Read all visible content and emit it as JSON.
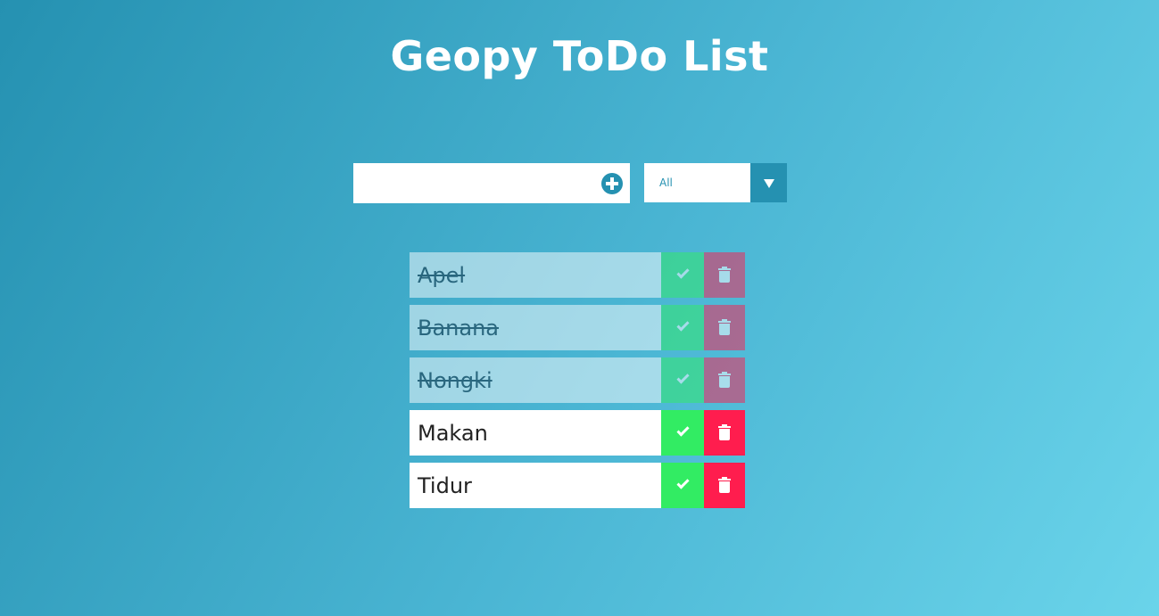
{
  "app": {
    "title": "Geopy ToDo List"
  },
  "form": {
    "input_value": "",
    "input_placeholder": "",
    "add_icon": "plus-circle-icon",
    "filter_selected": "All",
    "filter_options": [
      "All"
    ]
  },
  "todos": [
    {
      "text": "Apel",
      "completed": true
    },
    {
      "text": "Banana",
      "completed": true
    },
    {
      "text": "Nongki",
      "completed": true
    },
    {
      "text": "Makan",
      "completed": false
    },
    {
      "text": "Tidur",
      "completed": false
    }
  ],
  "colors": {
    "accent": "#2591b1",
    "complete_button": "#32ec63",
    "delete_button": "#ff1d4e"
  },
  "icons": {
    "complete": "check-icon",
    "delete": "trash-icon"
  }
}
